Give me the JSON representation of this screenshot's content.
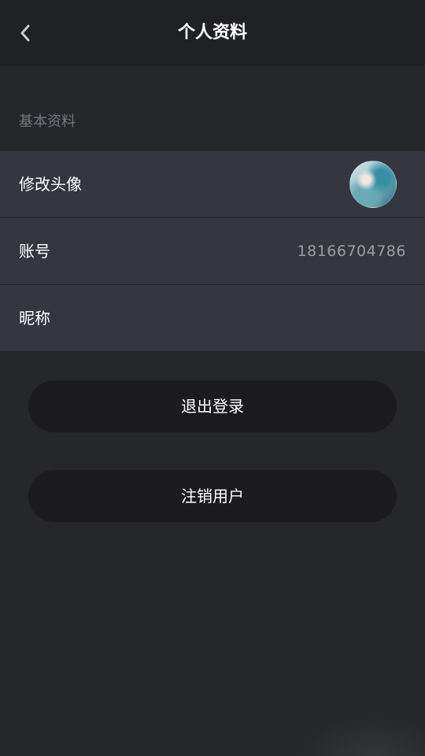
{
  "navbar": {
    "title": "个人资料",
    "back_icon": "chevron-left-icon"
  },
  "section": {
    "title": "基本资料"
  },
  "rows": {
    "avatar": {
      "label": "修改头像"
    },
    "account": {
      "label": "账号",
      "value": "18166704786"
    },
    "nickname": {
      "label": "昵称",
      "value": ""
    }
  },
  "actions": {
    "logout_label": "退出登录",
    "delete_user_label": "注销用户"
  },
  "colors": {
    "background": "#26272b",
    "navbar": "#202124",
    "row": "#35363f",
    "button": "#1c1c20",
    "muted_text": "#75767b",
    "value_text": "#9c9da2",
    "text": "#ffffff"
  }
}
